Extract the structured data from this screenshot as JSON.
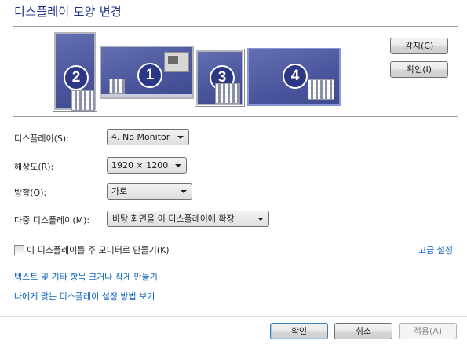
{
  "title": "디스플레이 모양 변경",
  "monitors": [
    {
      "id": "monitor-2",
      "number": "2"
    },
    {
      "id": "monitor-1",
      "number": "1"
    },
    {
      "id": "monitor-3",
      "number": "3"
    },
    {
      "id": "monitor-4",
      "number": "4"
    }
  ],
  "buttons": {
    "detect": "감지(C)",
    "identify": "확인(I)",
    "ok": "확인",
    "cancel": "취소",
    "apply": "적용(A)"
  },
  "fields": {
    "display": {
      "label": "디스플레이(S):",
      "value": "4. No Monitor"
    },
    "resolution": {
      "label": "해상도(R):",
      "value": "1920 × 1200"
    },
    "orientation": {
      "label": "방향(O):",
      "value": "가로"
    },
    "multiple": {
      "label": "다중 디스플레이(M):",
      "value": "바탕 화면을 이 디스플레이에 확장"
    }
  },
  "primary_checkbox": {
    "label": "이 디스플레이를 주 모니터로 만들기(K)",
    "checked": false
  },
  "links": {
    "advanced": "고급 설정",
    "text_size": "텍스트 및 기타 항목 크거나 작게 만들기",
    "which_settings": "나에게 맞는 디스플레이 설정 방법 보기"
  },
  "colors": {
    "title": "#1e3287",
    "link": "#0b62b8",
    "monitor": "#4a559c"
  }
}
